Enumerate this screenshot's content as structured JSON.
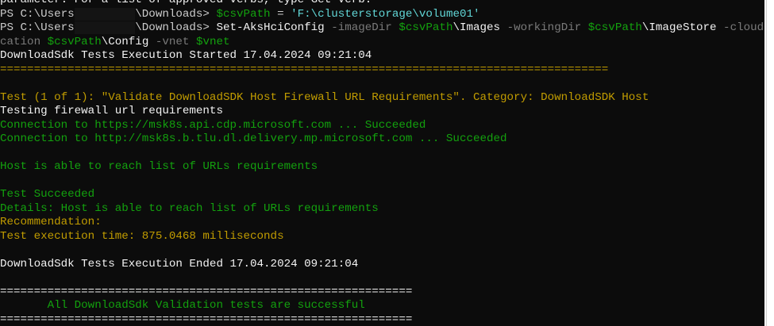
{
  "terminal": {
    "lines": [
      [
        {
          "t": "parameter. For a list of approved verbs, type Get-Verb.",
          "c": "white"
        }
      ],
      [
        {
          "t": "PS C:\\Users",
          "c": "gray"
        },
        {
          "t": "         ",
          "c": "redact"
        },
        {
          "t": "\\Downloads> ",
          "c": "gray"
        },
        {
          "t": "$csvPath",
          "c": "green"
        },
        {
          "t": " = ",
          "c": "gray"
        },
        {
          "t": "'F:\\clusterstorage\\volume01'",
          "c": "cyan"
        }
      ],
      [
        {
          "t": "PS C:\\Users",
          "c": "gray"
        },
        {
          "t": "         ",
          "c": "redact"
        },
        {
          "t": "\\Downloads> ",
          "c": "gray"
        },
        {
          "t": "Set-AksHciConfig",
          "c": "white"
        },
        {
          "t": " -imageDir ",
          "c": "dim"
        },
        {
          "t": "$csvPath",
          "c": "green"
        },
        {
          "t": "\\Images",
          "c": "white"
        },
        {
          "t": " -workingDir ",
          "c": "dim"
        },
        {
          "t": "$csvPath",
          "c": "green"
        },
        {
          "t": "\\ImageStore",
          "c": "white"
        },
        {
          "t": " -cloudConfigLo",
          "c": "dim"
        }
      ],
      [
        {
          "t": "cation ",
          "c": "dim"
        },
        {
          "t": "$csvPath",
          "c": "green"
        },
        {
          "t": "\\Config",
          "c": "white"
        },
        {
          "t": " -vnet ",
          "c": "dim"
        },
        {
          "t": "$vnet",
          "c": "green"
        }
      ],
      [
        {
          "t": "DownloadSdk Tests Execution Started 17.04.2024 09:21:04",
          "c": "white"
        }
      ],
      [
        {
          "t": "==========================================================================================",
          "c": "yellow"
        }
      ],
      [
        {
          "t": "",
          "c": "gray"
        }
      ],
      [
        {
          "t": "Test (1 of 1): \"Validate DownloadSDK Host Firewall URL Requirements\". Category: DownloadSDK Host",
          "c": "yellow"
        }
      ],
      [
        {
          "t": "Testing firewall url requirements",
          "c": "white"
        }
      ],
      [
        {
          "t": "Connection to https://msk8s.api.cdp.microsoft.com ... Succeeded",
          "c": "green"
        }
      ],
      [
        {
          "t": "Connection to http://msk8s.b.tlu.dl.delivery.mp.microsoft.com ... Succeeded",
          "c": "green"
        }
      ],
      [
        {
          "t": "",
          "c": "gray"
        }
      ],
      [
        {
          "t": "Host is able to reach list of URLs requirements",
          "c": "green"
        }
      ],
      [
        {
          "t": "",
          "c": "gray"
        }
      ],
      [
        {
          "t": "Test Succeeded",
          "c": "green"
        }
      ],
      [
        {
          "t": "Details: Host is able to reach list of URLs requirements",
          "c": "green"
        }
      ],
      [
        {
          "t": "Recommendation:",
          "c": "yellow"
        }
      ],
      [
        {
          "t": "Test execution time: 875.0468 milliseconds",
          "c": "yellow"
        }
      ],
      [
        {
          "t": "",
          "c": "gray"
        }
      ],
      [
        {
          "t": "DownloadSdk Tests Execution Ended 17.04.2024 09:21:04",
          "c": "white"
        }
      ],
      [
        {
          "t": "",
          "c": "gray"
        }
      ],
      [
        {
          "t": "=============================================================",
          "c": "white"
        }
      ],
      [
        {
          "t": "       All DownloadSdk Validation tests are successful",
          "c": "green"
        }
      ],
      [
        {
          "t": "=============================================================",
          "c": "white"
        }
      ]
    ]
  }
}
